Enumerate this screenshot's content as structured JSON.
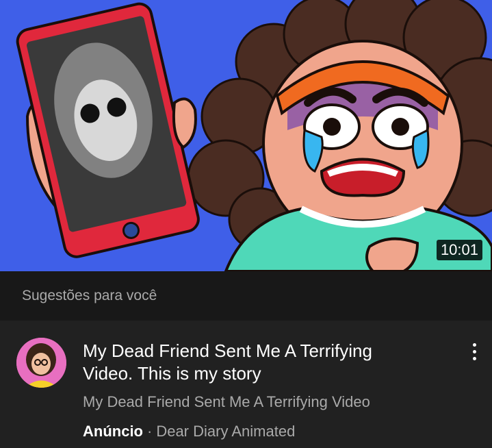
{
  "video": {
    "thumbnail_icon": "video-thumbnail",
    "duration": "10:01"
  },
  "section": {
    "title": "Sugestões para você"
  },
  "ad": {
    "title": "My Dead Friend Sent Me A Terrifying Video. This is my story",
    "subtitle": "My Dead Friend Sent Me A Terrifying Video",
    "ad_label": "Anúncio",
    "separator": "·",
    "channel": "Dear Diary Animated",
    "more_icon": "more-vert-icon",
    "avatar_icon": "channel-avatar"
  },
  "colors": {
    "thumbnail_background": "#3f5fe8",
    "page_background": "#212121",
    "header_background": "#181818",
    "secondary_text": "#aaaaaa"
  }
}
